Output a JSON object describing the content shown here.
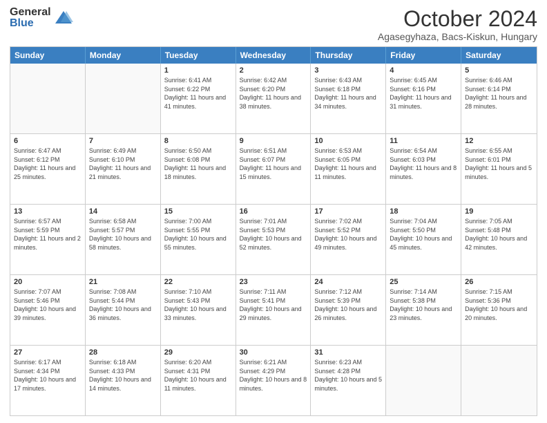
{
  "logo": {
    "general": "General",
    "blue": "Blue"
  },
  "title": "October 2024",
  "location": "Agasegyhaza, Bacs-Kiskun, Hungary",
  "header_days": [
    "Sunday",
    "Monday",
    "Tuesday",
    "Wednesday",
    "Thursday",
    "Friday",
    "Saturday"
  ],
  "weeks": [
    [
      {
        "day": "",
        "sunrise": "",
        "sunset": "",
        "daylight": "",
        "empty": true
      },
      {
        "day": "",
        "sunrise": "",
        "sunset": "",
        "daylight": "",
        "empty": true
      },
      {
        "day": "1",
        "sunrise": "Sunrise: 6:41 AM",
        "sunset": "Sunset: 6:22 PM",
        "daylight": "Daylight: 11 hours and 41 minutes.",
        "empty": false
      },
      {
        "day": "2",
        "sunrise": "Sunrise: 6:42 AM",
        "sunset": "Sunset: 6:20 PM",
        "daylight": "Daylight: 11 hours and 38 minutes.",
        "empty": false
      },
      {
        "day": "3",
        "sunrise": "Sunrise: 6:43 AM",
        "sunset": "Sunset: 6:18 PM",
        "daylight": "Daylight: 11 hours and 34 minutes.",
        "empty": false
      },
      {
        "day": "4",
        "sunrise": "Sunrise: 6:45 AM",
        "sunset": "Sunset: 6:16 PM",
        "daylight": "Daylight: 11 hours and 31 minutes.",
        "empty": false
      },
      {
        "day": "5",
        "sunrise": "Sunrise: 6:46 AM",
        "sunset": "Sunset: 6:14 PM",
        "daylight": "Daylight: 11 hours and 28 minutes.",
        "empty": false
      }
    ],
    [
      {
        "day": "6",
        "sunrise": "Sunrise: 6:47 AM",
        "sunset": "Sunset: 6:12 PM",
        "daylight": "Daylight: 11 hours and 25 minutes.",
        "empty": false
      },
      {
        "day": "7",
        "sunrise": "Sunrise: 6:49 AM",
        "sunset": "Sunset: 6:10 PM",
        "daylight": "Daylight: 11 hours and 21 minutes.",
        "empty": false
      },
      {
        "day": "8",
        "sunrise": "Sunrise: 6:50 AM",
        "sunset": "Sunset: 6:08 PM",
        "daylight": "Daylight: 11 hours and 18 minutes.",
        "empty": false
      },
      {
        "day": "9",
        "sunrise": "Sunrise: 6:51 AM",
        "sunset": "Sunset: 6:07 PM",
        "daylight": "Daylight: 11 hours and 15 minutes.",
        "empty": false
      },
      {
        "day": "10",
        "sunrise": "Sunrise: 6:53 AM",
        "sunset": "Sunset: 6:05 PM",
        "daylight": "Daylight: 11 hours and 11 minutes.",
        "empty": false
      },
      {
        "day": "11",
        "sunrise": "Sunrise: 6:54 AM",
        "sunset": "Sunset: 6:03 PM",
        "daylight": "Daylight: 11 hours and 8 minutes.",
        "empty": false
      },
      {
        "day": "12",
        "sunrise": "Sunrise: 6:55 AM",
        "sunset": "Sunset: 6:01 PM",
        "daylight": "Daylight: 11 hours and 5 minutes.",
        "empty": false
      }
    ],
    [
      {
        "day": "13",
        "sunrise": "Sunrise: 6:57 AM",
        "sunset": "Sunset: 5:59 PM",
        "daylight": "Daylight: 11 hours and 2 minutes.",
        "empty": false
      },
      {
        "day": "14",
        "sunrise": "Sunrise: 6:58 AM",
        "sunset": "Sunset: 5:57 PM",
        "daylight": "Daylight: 10 hours and 58 minutes.",
        "empty": false
      },
      {
        "day": "15",
        "sunrise": "Sunrise: 7:00 AM",
        "sunset": "Sunset: 5:55 PM",
        "daylight": "Daylight: 10 hours and 55 minutes.",
        "empty": false
      },
      {
        "day": "16",
        "sunrise": "Sunrise: 7:01 AM",
        "sunset": "Sunset: 5:53 PM",
        "daylight": "Daylight: 10 hours and 52 minutes.",
        "empty": false
      },
      {
        "day": "17",
        "sunrise": "Sunrise: 7:02 AM",
        "sunset": "Sunset: 5:52 PM",
        "daylight": "Daylight: 10 hours and 49 minutes.",
        "empty": false
      },
      {
        "day": "18",
        "sunrise": "Sunrise: 7:04 AM",
        "sunset": "Sunset: 5:50 PM",
        "daylight": "Daylight: 10 hours and 45 minutes.",
        "empty": false
      },
      {
        "day": "19",
        "sunrise": "Sunrise: 7:05 AM",
        "sunset": "Sunset: 5:48 PM",
        "daylight": "Daylight: 10 hours and 42 minutes.",
        "empty": false
      }
    ],
    [
      {
        "day": "20",
        "sunrise": "Sunrise: 7:07 AM",
        "sunset": "Sunset: 5:46 PM",
        "daylight": "Daylight: 10 hours and 39 minutes.",
        "empty": false
      },
      {
        "day": "21",
        "sunrise": "Sunrise: 7:08 AM",
        "sunset": "Sunset: 5:44 PM",
        "daylight": "Daylight: 10 hours and 36 minutes.",
        "empty": false
      },
      {
        "day": "22",
        "sunrise": "Sunrise: 7:10 AM",
        "sunset": "Sunset: 5:43 PM",
        "daylight": "Daylight: 10 hours and 33 minutes.",
        "empty": false
      },
      {
        "day": "23",
        "sunrise": "Sunrise: 7:11 AM",
        "sunset": "Sunset: 5:41 PM",
        "daylight": "Daylight: 10 hours and 29 minutes.",
        "empty": false
      },
      {
        "day": "24",
        "sunrise": "Sunrise: 7:12 AM",
        "sunset": "Sunset: 5:39 PM",
        "daylight": "Daylight: 10 hours and 26 minutes.",
        "empty": false
      },
      {
        "day": "25",
        "sunrise": "Sunrise: 7:14 AM",
        "sunset": "Sunset: 5:38 PM",
        "daylight": "Daylight: 10 hours and 23 minutes.",
        "empty": false
      },
      {
        "day": "26",
        "sunrise": "Sunrise: 7:15 AM",
        "sunset": "Sunset: 5:36 PM",
        "daylight": "Daylight: 10 hours and 20 minutes.",
        "empty": false
      }
    ],
    [
      {
        "day": "27",
        "sunrise": "Sunrise: 6:17 AM",
        "sunset": "Sunset: 4:34 PM",
        "daylight": "Daylight: 10 hours and 17 minutes.",
        "empty": false
      },
      {
        "day": "28",
        "sunrise": "Sunrise: 6:18 AM",
        "sunset": "Sunset: 4:33 PM",
        "daylight": "Daylight: 10 hours and 14 minutes.",
        "empty": false
      },
      {
        "day": "29",
        "sunrise": "Sunrise: 6:20 AM",
        "sunset": "Sunset: 4:31 PM",
        "daylight": "Daylight: 10 hours and 11 minutes.",
        "empty": false
      },
      {
        "day": "30",
        "sunrise": "Sunrise: 6:21 AM",
        "sunset": "Sunset: 4:29 PM",
        "daylight": "Daylight: 10 hours and 8 minutes.",
        "empty": false
      },
      {
        "day": "31",
        "sunrise": "Sunrise: 6:23 AM",
        "sunset": "Sunset: 4:28 PM",
        "daylight": "Daylight: 10 hours and 5 minutes.",
        "empty": false
      },
      {
        "day": "",
        "sunrise": "",
        "sunset": "",
        "daylight": "",
        "empty": true
      },
      {
        "day": "",
        "sunrise": "",
        "sunset": "",
        "daylight": "",
        "empty": true
      }
    ]
  ]
}
